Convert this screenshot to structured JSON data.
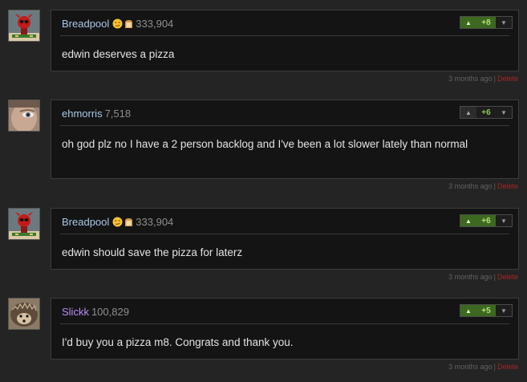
{
  "comments": [
    {
      "username": "Breadpool",
      "score": "333,904",
      "emoji": "smirk-face",
      "badge": "bread",
      "votes": "+8",
      "text": "edwin deserves a pizza",
      "time": "3 months ago",
      "separator": "|",
      "delete_label": "Delete"
    },
    {
      "username": "ehmorris",
      "score": "7,518",
      "votes": "+6",
      "text": "oh god plz no I have a 2 person backlog and I've been a lot slower lately than normal",
      "time": "3 months ago",
      "separator": "|",
      "delete_label": "Delete"
    },
    {
      "username": "Breadpool",
      "score": "333,904",
      "emoji": "smirk-face",
      "badge": "bread",
      "votes": "+6",
      "text": "edwin should save the pizza for laterz",
      "time": "3 months ago",
      "separator": "|",
      "delete_label": "Delete"
    },
    {
      "username": "Slickk",
      "score": "100,829",
      "votes": "+5",
      "text": "I'd buy you a pizza m8. Congrats and thank you.",
      "time": "3 months ago",
      "separator": "|",
      "delete_label": "Delete"
    }
  ],
  "colors": {
    "username": "#a8c8ea",
    "username_special": "#b78cf6",
    "vote_positive": "#3d6820",
    "delete": "#a82525"
  }
}
